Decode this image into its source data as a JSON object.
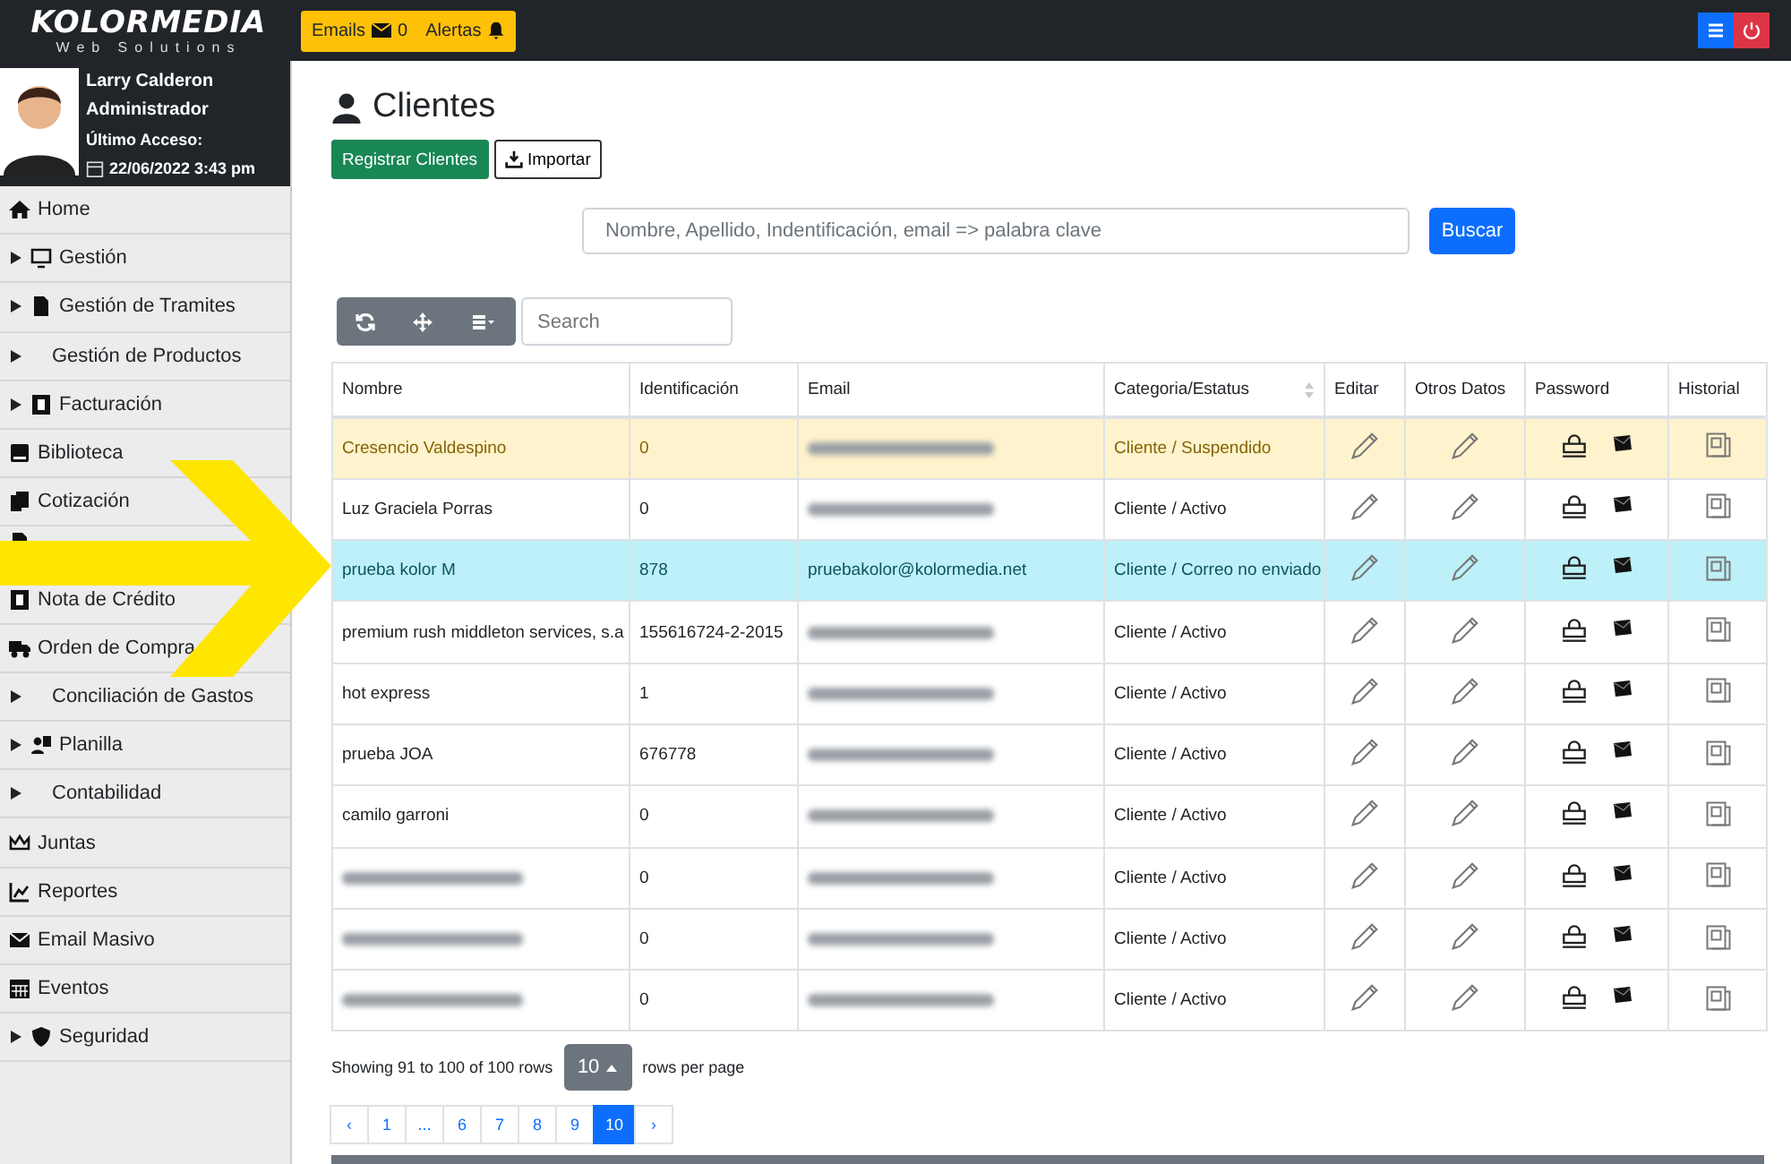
{
  "brand": {
    "name": "KOLORMEDIA",
    "tagline": "Web Solutions"
  },
  "topbar": {
    "emails_label": "Emails",
    "emails_count": "0",
    "alerts_label": "Alertas"
  },
  "user": {
    "name": "Larry Calderon",
    "role": "Administrador",
    "last_access_label": "Último Acceso:",
    "last_access": "22/06/2022 3:43 pm"
  },
  "sidebar": {
    "items": [
      {
        "label": "Home",
        "kind": "home",
        "expandable": false
      },
      {
        "label": "Gestión",
        "kind": "monitor",
        "expandable": true
      },
      {
        "label": "Gestión de Tramites",
        "kind": "file",
        "expandable": true
      },
      {
        "label": "Gestión de Productos",
        "kind": "plain",
        "expandable": true
      },
      {
        "label": "Facturación",
        "kind": "dollar",
        "expandable": true
      },
      {
        "label": "Biblioteca",
        "kind": "book",
        "expandable": false
      },
      {
        "label": "Cotización",
        "kind": "copy",
        "expandable": false
      },
      {
        "kind": "file"
      },
      {
        "label": "Nota de Crédito",
        "kind": "dollar",
        "expandable": false
      },
      {
        "label": "Orden de Compra",
        "kind": "truck",
        "expandable": false
      },
      {
        "label": "Conciliación de Gastos",
        "kind": "plain",
        "expandable": true
      },
      {
        "label": "Planilla",
        "kind": "people",
        "expandable": true
      },
      {
        "label": "Contabilidad",
        "kind": "plain",
        "expandable": true
      },
      {
        "label": "Juntas",
        "kind": "crown",
        "expandable": false
      },
      {
        "label": "Reportes",
        "kind": "chart",
        "expandable": false
      },
      {
        "label": "Email Masivo",
        "kind": "mail",
        "expandable": false
      },
      {
        "label": "Eventos",
        "kind": "calendar",
        "expandable": false
      },
      {
        "label": "Seguridad",
        "kind": "shield",
        "expandable": true
      }
    ]
  },
  "page": {
    "title": "Clientes",
    "register_button": "Registrar Clientes",
    "import_button": "Importar"
  },
  "search": {
    "placeholder": "Nombre, Apellido, Indentificación, email => palabra clave",
    "button": "Buscar"
  },
  "toolbar": {
    "search_placeholder": "Search"
  },
  "table": {
    "columns": [
      {
        "label": "Nombre",
        "sortable": false
      },
      {
        "label": "Identificación",
        "sortable": false
      },
      {
        "label": "Email",
        "sortable": false
      },
      {
        "label": "Categoria/Estatus",
        "sortable": true
      },
      {
        "label": "Editar",
        "sortable": false
      },
      {
        "label": "Otros Datos",
        "sortable": false
      },
      {
        "label": "Password",
        "sortable": false
      },
      {
        "label": "Historial",
        "sortable": false
      }
    ],
    "rows": [
      {
        "name": "Cresencio Valdespino",
        "id": "0",
        "email_redacted": true,
        "status": "Cliente / Suspendido",
        "kind": "warning"
      },
      {
        "name": "Luz Graciela Porras",
        "id": "0",
        "email_redacted": true,
        "status": "Cliente / Activo",
        "kind": "normal"
      },
      {
        "name": "prueba kolor M",
        "id": "878",
        "email": "pruebakolor@kolormedia.net",
        "email_redacted": false,
        "status": "Cliente / Correo no enviado",
        "kind": "info"
      },
      {
        "name": "premium rush middleton services, s.a",
        "id": "155616724-2-2015",
        "email_redacted": true,
        "status": "Cliente / Activo",
        "kind": "normal"
      },
      {
        "name": "hot express",
        "id": "1",
        "email_redacted": true,
        "status": "Cliente / Activo",
        "kind": "normal"
      },
      {
        "name": "prueba JOA",
        "id": "676778",
        "email_redacted": true,
        "status": "Cliente / Activo",
        "kind": "normal"
      },
      {
        "name": "camilo garroni",
        "id": "0",
        "email_redacted": true,
        "status": "Cliente / Activo",
        "kind": "normal"
      },
      {
        "name_redacted": true,
        "id": "0",
        "email_redacted": true,
        "status": "Cliente / Activo",
        "kind": "normal"
      },
      {
        "name_redacted": true,
        "id": "0",
        "email_redacted": true,
        "status": "Cliente / Activo",
        "kind": "normal"
      },
      {
        "name_redacted": true,
        "id": "0",
        "email_redacted": true,
        "status": "Cliente / Activo",
        "kind": "normal"
      }
    ]
  },
  "pagination": {
    "summary": "Showing 91 to 100 of 100 rows",
    "page_size": "10",
    "page_size_suffix": "rows per page",
    "pages": [
      {
        "label": "‹",
        "selected": false
      },
      {
        "label": "1",
        "selected": false
      },
      {
        "label": "...",
        "selected": false
      },
      {
        "label": "6",
        "selected": false
      },
      {
        "label": "7",
        "selected": false
      },
      {
        "label": "8",
        "selected": false
      },
      {
        "label": "9",
        "selected": false
      },
      {
        "label": "10",
        "selected": true
      },
      {
        "label": "›",
        "selected": false
      }
    ]
  }
}
